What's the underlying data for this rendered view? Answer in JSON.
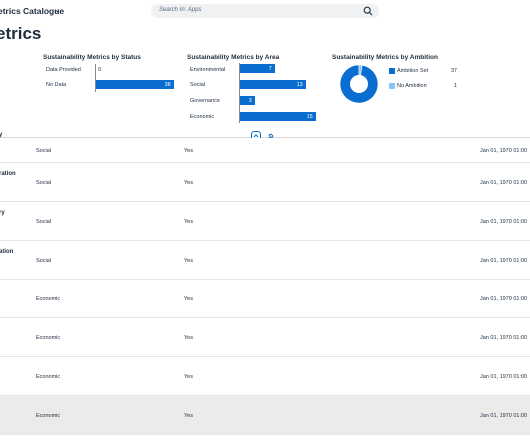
{
  "shell": {
    "app_title": "etrics Catalogue",
    "search_placeholder": "Search In: Apps"
  },
  "page_title": "etrics",
  "charts": {
    "status": {
      "title": "Sustainability Metrics by Status",
      "categories": [
        "Data Provided",
        "No Data"
      ],
      "values": [
        0,
        38
      ]
    },
    "area": {
      "title": "Sustainability Metrics by Area",
      "categories": [
        "Environmental",
        "Social",
        "Governance",
        "Economic"
      ],
      "values": [
        7,
        13,
        3,
        15
      ]
    },
    "ambition": {
      "title": "Sustainability Metrics by Ambition",
      "legend": [
        {
          "label": "Ambition Set",
          "value": "37",
          "color": "#0a6ed1"
        },
        {
          "label": "No Ambition",
          "value": "1",
          "color": "#89c4f4"
        }
      ]
    }
  },
  "chart_data": [
    {
      "type": "bar",
      "orientation": "horizontal",
      "title": "Sustainability Metrics by Status",
      "categories": [
        "Data Provided",
        "No Data"
      ],
      "values": [
        0,
        38
      ]
    },
    {
      "type": "bar",
      "orientation": "horizontal",
      "title": "Sustainability Metrics by Area",
      "categories": [
        "Environmental",
        "Social",
        "Governance",
        "Economic"
      ],
      "values": [
        7,
        13,
        3,
        15
      ]
    },
    {
      "type": "pie",
      "donut": true,
      "title": "Sustainability Metrics by Ambition",
      "categories": [
        "Ambition Set",
        "No Ambition"
      ],
      "values": [
        37,
        1
      ]
    }
  ],
  "table": {
    "rows": [
      {
        "title": "y",
        "area": "Social",
        "ambition": "Yes",
        "date": "Jan 01, 1970 01:00",
        "selected": false
      },
      {
        "title": "ration",
        "area": "Social",
        "ambition": "Yes",
        "date": "Jan 01, 1970 01:00",
        "selected": false
      },
      {
        "title": "ry",
        "area": "Social",
        "ambition": "Yes",
        "date": "Jan 01, 1970 01:00",
        "selected": false
      },
      {
        "title": "ation",
        "area": "Social",
        "ambition": "Yes",
        "date": "Jan 01, 1970 01:00",
        "selected": false
      },
      {
        "title": "",
        "area": "Economic",
        "ambition": "Yes",
        "date": "Jan 01, 1970 01:00",
        "selected": false
      },
      {
        "title": "",
        "area": "Economic",
        "ambition": "Yes",
        "date": "Jan 01, 1970 01:00",
        "selected": false
      },
      {
        "title": "",
        "area": "Economic",
        "ambition": "Yes",
        "date": "Jan 01, 1970 01:00",
        "selected": false
      },
      {
        "title": "",
        "area": "Economic",
        "ambition": "Yes",
        "date": "Jan 01, 1970 01:00",
        "selected": true
      }
    ]
  },
  "icons": {
    "search": "search-icon",
    "chevron": "chevron-down-icon",
    "collapse": "collapse-header-icon",
    "pin": "pin-header-icon"
  },
  "colors": {
    "bar": "#0a6ed1",
    "donut_main": "#0a6ed1",
    "donut_minor": "#89c4f4"
  }
}
